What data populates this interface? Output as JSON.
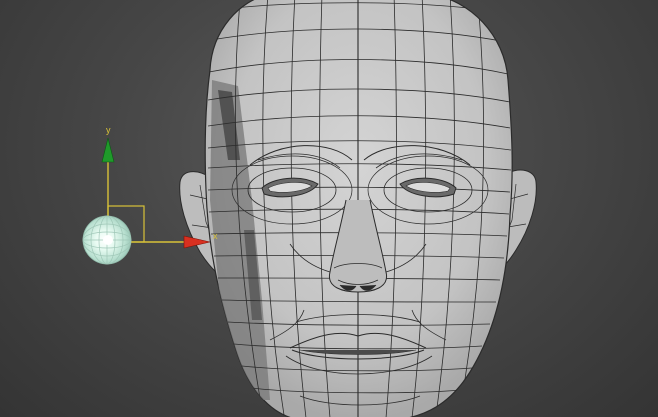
{
  "viewport": {
    "background_color": "#474747",
    "mesh_color": "#c9c9c9",
    "wire_color": "#2b2b2b"
  },
  "gizmo": {
    "x_label": "x",
    "y_label": "y",
    "x_color": "#d83020",
    "y_color": "#1f9a2a",
    "plane_color": "#d8c238"
  },
  "light": {
    "icon": "omni-light-icon",
    "color": "#cfeee0"
  }
}
